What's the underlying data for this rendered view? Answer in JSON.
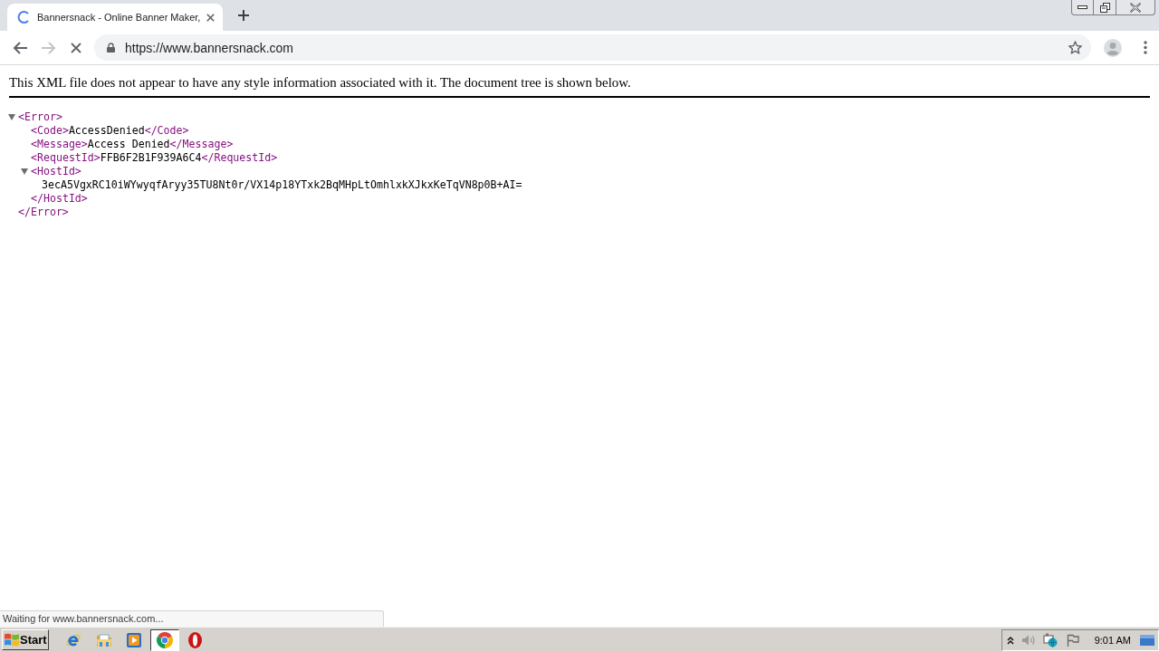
{
  "browser": {
    "loading": true,
    "tabs": [
      {
        "title": "Bannersnack - Online Banner Maker,",
        "selected": true
      }
    ],
    "address_bar": {
      "url": "https://www.bannersnack.com"
    }
  },
  "xml_viewer": {
    "notice": "This XML file does not appear to have any style information associated with it. The document tree is shown below.",
    "tree": [
      {
        "open_tag": "<Error>",
        "expanded": true,
        "children": [
          {
            "open_tag": "<Code>",
            "text": "AccessDenied",
            "close_tag": "</Code>"
          },
          {
            "open_tag": "<Message>",
            "text": "Access Denied",
            "close_tag": "</Message>"
          },
          {
            "open_tag": "<RequestId>",
            "text": "FFB6F2B1F939A6C4",
            "close_tag": "</RequestId>"
          },
          {
            "open_tag": "<HostId>",
            "expanded": true,
            "children": [
              {
                "text": "3ecA5VgxRC10iWYwyqfAryy35TU8Nt0r/VX14p18YTxk2BqMHpLtOmhlxkXJkxKeTqVN8p0B+AI="
              }
            ],
            "close_tag": "</HostId>"
          }
        ],
        "close_tag": "</Error>"
      }
    ]
  },
  "status_bubble": {
    "text": "Waiting for www.bannersnack.com..."
  },
  "taskbar": {
    "start_label": "Start",
    "apps": [
      {
        "kind": "ie",
        "selected": false
      },
      {
        "kind": "folder",
        "selected": false
      },
      {
        "kind": "player",
        "selected": false
      },
      {
        "kind": "chrome",
        "selected": true
      },
      {
        "kind": "opera",
        "selected": false
      }
    ],
    "clock": "9:01 AM"
  }
}
